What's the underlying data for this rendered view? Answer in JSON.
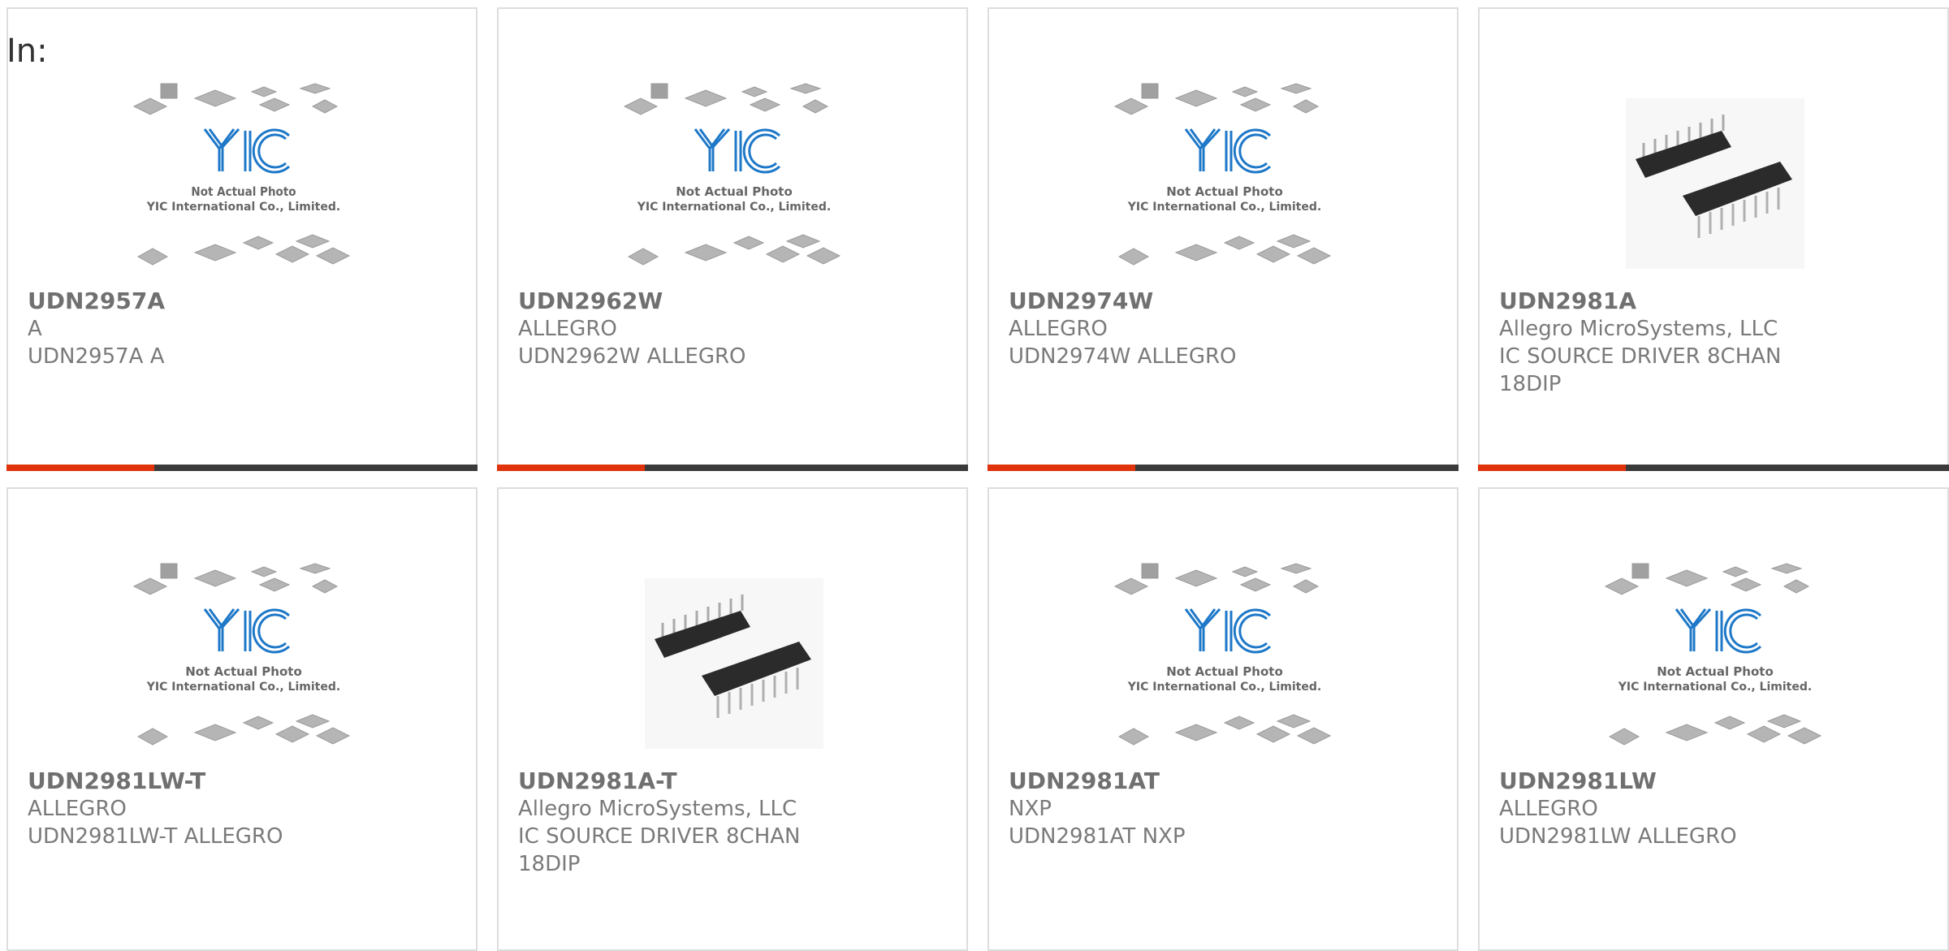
{
  "page": {
    "in_label": "In:"
  },
  "products": [
    {
      "part": "UDN2957A",
      "brand": "A",
      "desc": "UDN2957A A",
      "image": "placeholder"
    },
    {
      "part": "UDN2962W",
      "brand": "ALLEGRO",
      "desc": "UDN2962W ALLEGRO",
      "image": "placeholder"
    },
    {
      "part": "UDN2974W",
      "brand": "ALLEGRO",
      "desc": "UDN2974W ALLEGRO",
      "image": "placeholder"
    },
    {
      "part": "UDN2981A",
      "brand": "Allegro MicroSystems, LLC",
      "desc": "IC SOURCE DRIVER 8CHAN 18DIP",
      "image": "dip-photo"
    },
    {
      "part": "UDN2981LW-T",
      "brand": "ALLEGRO",
      "desc": "UDN2981LW-T ALLEGRO",
      "image": "placeholder"
    },
    {
      "part": "UDN2981A-T",
      "brand": "Allegro MicroSystems, LLC",
      "desc": "IC SOURCE DRIVER 8CHAN 18DIP",
      "image": "dip-photo"
    },
    {
      "part": "UDN2981AT",
      "brand": "NXP",
      "desc": "UDN2981AT NXP",
      "image": "placeholder"
    },
    {
      "part": "UDN2981LW",
      "brand": "ALLEGRO",
      "desc": "UDN2981LW ALLEGRO",
      "image": "placeholder"
    }
  ],
  "placeholder_image": {
    "line1": "Not Actual Photo",
    "line2": "YIC International Co., Limited.",
    "logo": "YIC"
  },
  "colors": {
    "accent": "#e0330c",
    "bar": "#3a3a3a",
    "logo_blue": "#1e78c8"
  }
}
